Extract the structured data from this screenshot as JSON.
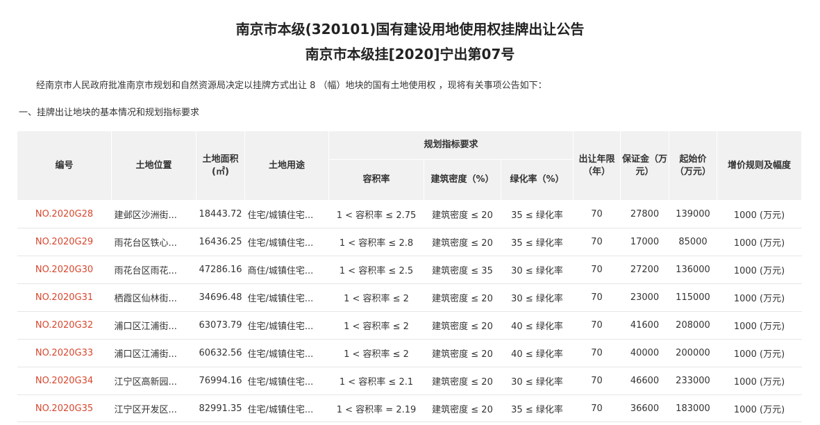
{
  "title_line1": "南京市本级(320101)国有建设用地使用权挂牌出让公告",
  "title_line2": "南京市本级挂[2020]宁出第07号",
  "intro": "经南京市人民政府批准南京市规划和自然资源局决定以挂牌方式出让 8 （幅）地块的国有土地使用权 ，现将有关事项公告如下：",
  "section_heading": "一、挂牌出让地块的基本情况和规划指标要求",
  "table": {
    "headers": {
      "code": "编号",
      "location": "土地位置",
      "area": "土地面积(㎡)",
      "use": "土地用途",
      "planning_group": "规划指标要求",
      "far": "容积率",
      "density": "建筑密度（%）",
      "green": "绿化率（%）",
      "term": "出让年限（年）",
      "deposit": "保证金（万元）",
      "start_price": "起始价（万元）",
      "increment": "增价规则及幅度"
    },
    "rows": [
      {
        "code": "NO.2020G28",
        "location": "建邺区沙洲街...",
        "area": "18443.72",
        "use": "住宅/城镇住宅...",
        "far": "1 < 容积率 ≤ 2.75",
        "density": "建筑密度 ≤ 20",
        "green": "35 ≤ 绿化率",
        "term": "70",
        "deposit": "27800",
        "start_price": "139000",
        "increment": "1000 (万元)"
      },
      {
        "code": "NO.2020G29",
        "location": "雨花台区铁心...",
        "area": "16436.25",
        "use": "住宅/城镇住宅...",
        "far": "1 < 容积率 ≤ 2.8",
        "density": "建筑密度 ≤ 20",
        "green": "35 ≤ 绿化率",
        "term": "70",
        "deposit": "17000",
        "start_price": "85000",
        "increment": "1000 (万元)"
      },
      {
        "code": "NO.2020G30",
        "location": "雨花台区雨花...",
        "area": "47286.16",
        "use": "商住/城镇住宅...",
        "far": "1 < 容积率 ≤ 2.5",
        "density": "建筑密度 ≤ 35",
        "green": "30 ≤ 绿化率",
        "term": "70",
        "deposit": "27200",
        "start_price": "136000",
        "increment": "1000 (万元)"
      },
      {
        "code": "NO.2020G31",
        "location": "栖霞区仙林街...",
        "area": "34696.48",
        "use": "住宅/城镇住宅...",
        "far": "1 < 容积率 ≤ 2",
        "density": "建筑密度 ≤ 20",
        "green": "30 ≤ 绿化率",
        "term": "70",
        "deposit": "23000",
        "start_price": "115000",
        "increment": "1000 (万元)"
      },
      {
        "code": "NO.2020G32",
        "location": "浦口区江浦街...",
        "area": "63073.79",
        "use": "住宅/城镇住宅...",
        "far": "1 < 容积率 ≤ 2",
        "density": "建筑密度 ≤ 20",
        "green": "40 ≤ 绿化率",
        "term": "70",
        "deposit": "41600",
        "start_price": "208000",
        "increment": "1000 (万元)"
      },
      {
        "code": "NO.2020G33",
        "location": "浦口区江浦街...",
        "area": "60632.56",
        "use": "住宅/城镇住宅...",
        "far": "1 < 容积率 ≤ 2",
        "density": "建筑密度 ≤ 20",
        "green": "40 ≤ 绿化率",
        "term": "70",
        "deposit": "40000",
        "start_price": "200000",
        "increment": "1000 (万元)"
      },
      {
        "code": "NO.2020G34",
        "location": "江宁区高新园...",
        "area": "76994.16",
        "use": "住宅/城镇住宅...",
        "far": "1 < 容积率 ≤ 2.1",
        "density": "建筑密度 ≤ 20",
        "green": "30 ≤ 绿化率",
        "term": "70",
        "deposit": "46600",
        "start_price": "233000",
        "increment": "1000 (万元)"
      },
      {
        "code": "NO.2020G35",
        "location": "江宁区开发区...",
        "area": "82991.35",
        "use": "住宅/城镇住宅...",
        "far": "1 < 容积率 = 2.19",
        "density": "建筑密度 ≤ 20",
        "green": "35 ≤ 绿化率",
        "term": "70",
        "deposit": "36600",
        "start_price": "183000",
        "increment": "1000 (万元)"
      }
    ]
  }
}
